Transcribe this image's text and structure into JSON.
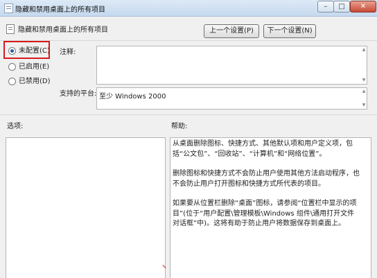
{
  "window": {
    "title": "隐藏和禁用桌面上的所有项目",
    "min_glyph": "–",
    "max_glyph": "□",
    "close_glyph": "✕"
  },
  "header": {
    "policy_title": "隐藏和禁用桌面上的所有项目",
    "prev_button": "上一个设置(P)",
    "next_button": "下一个设置(N)"
  },
  "state": {
    "options": [
      {
        "label": "未配置(C)",
        "checked": true
      },
      {
        "label": "已启用(E)",
        "checked": false
      },
      {
        "label": "已禁用(D)",
        "checked": false
      }
    ]
  },
  "comment": {
    "label": "注释:",
    "value": ""
  },
  "platform": {
    "label": "支持的平台:",
    "value": "至少 Windows 2000"
  },
  "options_panel": {
    "label": "选项:"
  },
  "help_panel": {
    "label": "帮助:",
    "paragraphs": [
      "从桌面删除图标、快捷方式、其他默认项和用户定义项，包括“公文包”、“回收站”、“计算机”和“网络位置”。",
      "删除图标和快捷方式不会防止用户使用其他方法启动程序，也不会防止用户打开图标和快捷方式所代表的项目。",
      "如果要从位置栏删除“桌面”图标，请参阅“位置栏中显示的项目”(位于“用户配置\\管理模板\\Windows 组件\\通用打开文件对话框”中)。这将有助于防止用户将数据保存到桌面上。"
    ]
  },
  "colors": {
    "highlight_box": "#d7191c",
    "radio_dot": "#2a5cb3"
  }
}
